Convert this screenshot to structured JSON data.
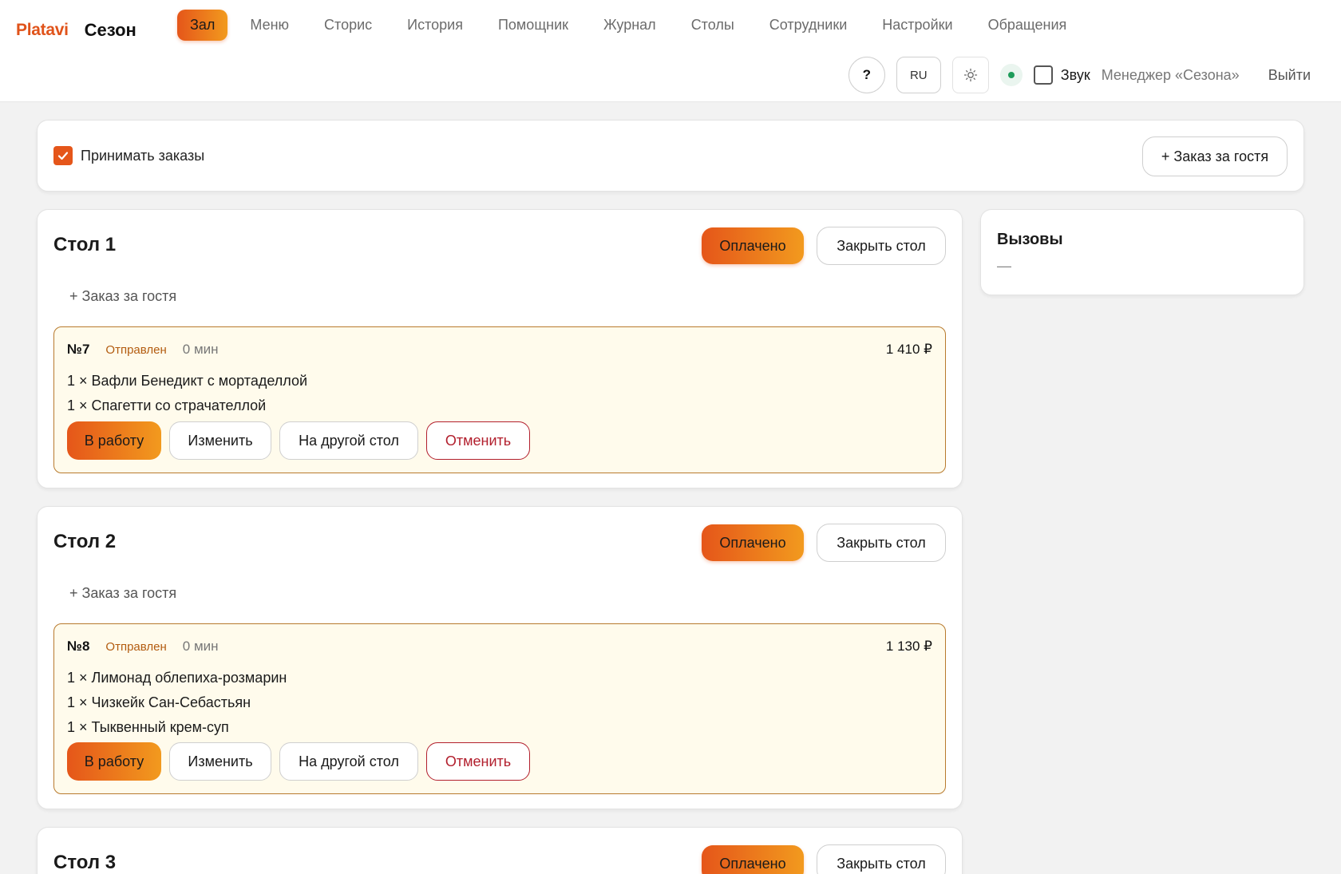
{
  "brand": {
    "logo": "Platavi",
    "venue": "Сезон"
  },
  "nav": {
    "items": [
      {
        "label": "Зал",
        "active": true
      },
      {
        "label": "Меню"
      },
      {
        "label": "Сторис"
      },
      {
        "label": "История"
      },
      {
        "label": "Помощник"
      },
      {
        "label": "Журнал"
      },
      {
        "label": "Столы"
      },
      {
        "label": "Сотрудники"
      },
      {
        "label": "Настройки"
      },
      {
        "label": "Обращения"
      }
    ]
  },
  "toolbar": {
    "help_label": "?",
    "lang_label": "RU",
    "theme_icon": "sun-icon",
    "sound_label": "Звук",
    "manager_label": "Менеджер «Сезона»",
    "logout_label": "Выйти"
  },
  "accept": {
    "label": "Принимать заказы",
    "checked": true,
    "guest_order_label": "+ Заказ за гостя"
  },
  "calls": {
    "title": "Вызовы",
    "empty": "—"
  },
  "tables": [
    {
      "title": "Стол 1",
      "paid_label": "Оплачено",
      "close_label": "Закрыть стол",
      "add_guest_label": "+ Заказ за гостя",
      "order": {
        "number": "№7",
        "status": "Отправлен",
        "time": "0 мин",
        "total": "1 410 ₽",
        "items": [
          "1 × Вафли Бенедикт с мортаделлой",
          "1 × Спагетти со страчателлой"
        ],
        "actions": {
          "work": "В работу",
          "edit": "Изменить",
          "move": "На другой стол",
          "cancel": "Отменить"
        }
      }
    },
    {
      "title": "Стол 2",
      "paid_label": "Оплачено",
      "close_label": "Закрыть стол",
      "add_guest_label": "+ Заказ за гостя",
      "order": {
        "number": "№8",
        "status": "Отправлен",
        "time": "0 мин",
        "total": "1 130 ₽",
        "items": [
          "1 × Лимонад облепиха-розмарин",
          "1 × Чизкейк Сан-Себастьян",
          "1 × Тыквенный крем-суп"
        ],
        "actions": {
          "work": "В работу",
          "edit": "Изменить",
          "move": "На другой стол",
          "cancel": "Отменить"
        }
      }
    },
    {
      "title": "Стол 3",
      "paid_label": "Оплачено",
      "close_label": "Закрыть стол"
    }
  ]
}
